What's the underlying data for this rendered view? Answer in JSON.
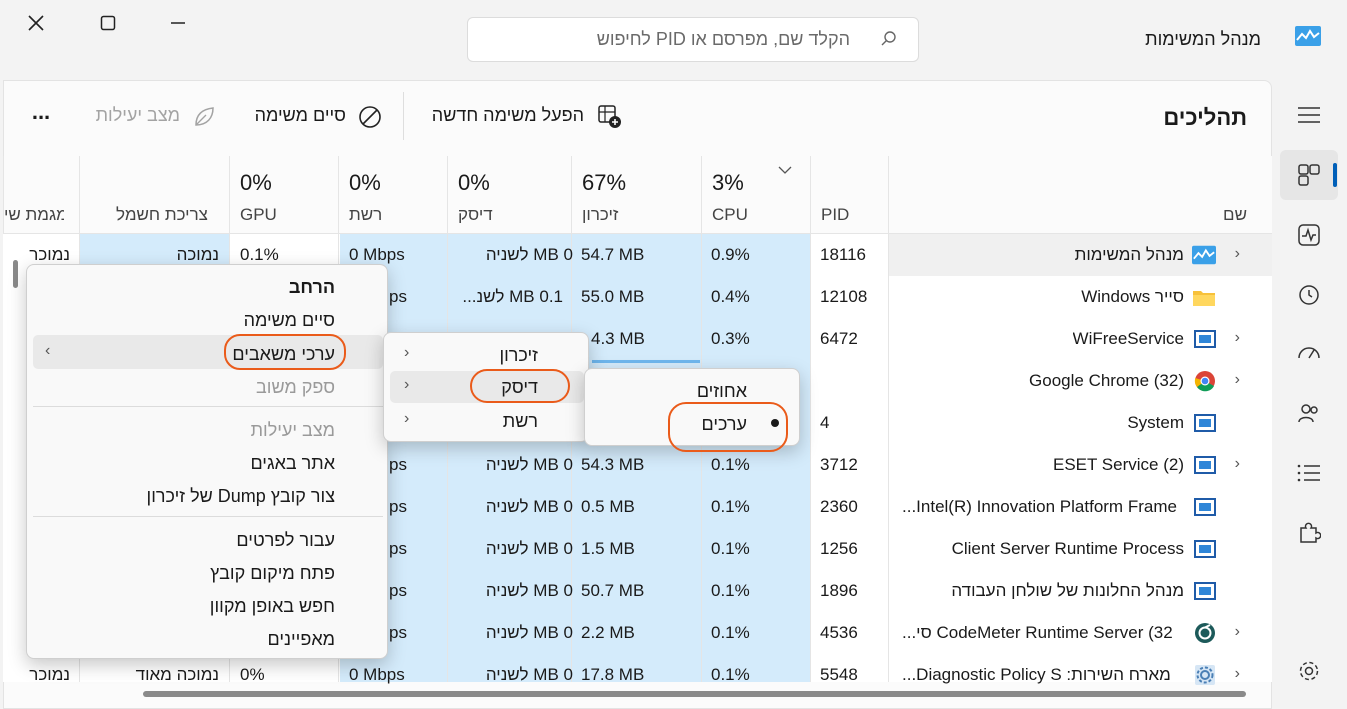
{
  "app": {
    "title": "מנהל המשימות",
    "search_placeholder": "הקלד שם, מפרסם או PID לחיפוש"
  },
  "toolbar": {
    "page_title": "תהליכים",
    "run_new_task": "הפעל משימה חדשה",
    "end_task": "סיים משימה",
    "efficiency_mode": "מצב יעילות",
    "more": "..."
  },
  "columns": {
    "name": "שם",
    "pid": "PID",
    "cpu": {
      "pct": "3%",
      "label": "CPU"
    },
    "memory": {
      "pct": "67%",
      "label": "זיכרון"
    },
    "disk": {
      "pct": "0%",
      "label": "דיסק"
    },
    "network": {
      "pct": "0%",
      "label": "רשת"
    },
    "gpu": {
      "pct": "0%",
      "label": "GPU"
    },
    "power_usage": "צריכת חשמל",
    "power_trend": "מגמת שי"
  },
  "rows": [
    {
      "name": "מנהל המשימות",
      "pid": "18116",
      "cpu": "0.9%",
      "mem": "54.7 MB",
      "disk": "0 MB לשניה",
      "net": "0 Mbps",
      "gpu": "0.1%",
      "power": "נמוכה",
      "trend": "נמוכר",
      "icon": "taskmgr-icon",
      "expand": true
    },
    {
      "name": "סייר Windows",
      "pid": "12108",
      "cpu": "0.4%",
      "mem": "55.0 MB",
      "disk": "0.1 MB לשנ...",
      "net": "ps",
      "icon": "folder-icon",
      "expand": false
    },
    {
      "name": "WiFreeService",
      "pid": "6472",
      "cpu": "0.3%",
      "mem": "4.3 MB",
      "icon": "app-icon",
      "expand": true
    },
    {
      "name": "Google Chrome (32)",
      "pid": "",
      "cpu": "",
      "mem": "",
      "icon": "chrome-icon",
      "expand": true
    },
    {
      "name": "System",
      "pid": "4",
      "icon": "app-icon",
      "expand": false
    },
    {
      "name": "ESET Service (2)",
      "pid": "3712",
      "cpu": "0.1%",
      "mem": "54.3 MB",
      "disk": "0 MB לשניה",
      "net": "ps",
      "icon": "app-icon",
      "expand": true
    },
    {
      "name": "Intel(R) Innovation Platform Frame...",
      "pid": "2360",
      "cpu": "0.1%",
      "mem": "0.5 MB",
      "disk": "0 MB לשניה",
      "net": "ps",
      "icon": "app-icon",
      "expand": false
    },
    {
      "name": "Client Server Runtime Process",
      "pid": "1256",
      "cpu": "0.1%",
      "mem": "1.5 MB",
      "disk": "0 MB לשניה",
      "net": "ps",
      "icon": "app-icon",
      "expand": false
    },
    {
      "name": "מנהל החלונות של שולחן העבודה",
      "pid": "1896",
      "cpu": "0.1%",
      "mem": "50.7 MB",
      "disk": "0 MB לשניה",
      "net": "ps",
      "icon": "app-icon",
      "expand": false
    },
    {
      "name": "CodeMeter Runtime Server (32 סי...",
      "pid": "4536",
      "cpu": "0.1%",
      "mem": "2.2 MB",
      "disk": "0 MB לשניה",
      "net": "ps",
      "icon": "codemeter-icon",
      "expand": true
    },
    {
      "name": "מארח השירות: Diagnostic Policy S...",
      "pid": "5548",
      "cpu": "0.1%",
      "mem": "17.8 MB",
      "disk": "0 MB לשניה",
      "net": "0 Mbps",
      "gpu": "0%",
      "power": "נמוכה מאוד",
      "trend": "נמוכר",
      "icon": "service-icon",
      "expand": true
    }
  ],
  "context_menu": {
    "expand": "הרחב",
    "end_task": "סיים משימה",
    "resource_values": "ערכי משאבים",
    "provide_feedback": "ספק משוב",
    "efficiency_mode": "מצב יעילות",
    "debug": "אתר באגים",
    "create_dump": "צור קובץ Dump של זיכרון",
    "go_to_details": "עבור לפרטים",
    "open_file_location": "פתח מיקום קובץ",
    "search_online": "חפש באופן מקוון",
    "properties": "מאפיינים"
  },
  "submenu_resources": {
    "memory": "זיכרון",
    "disk": "דיסק",
    "network": "רשת"
  },
  "submenu_disk": {
    "percent": "אחוזים",
    "values": "ערכים"
  },
  "colors": {
    "accent": "#005fb8",
    "column_highlight": "#d4ebfb",
    "annotation": "#ea5b1a"
  }
}
